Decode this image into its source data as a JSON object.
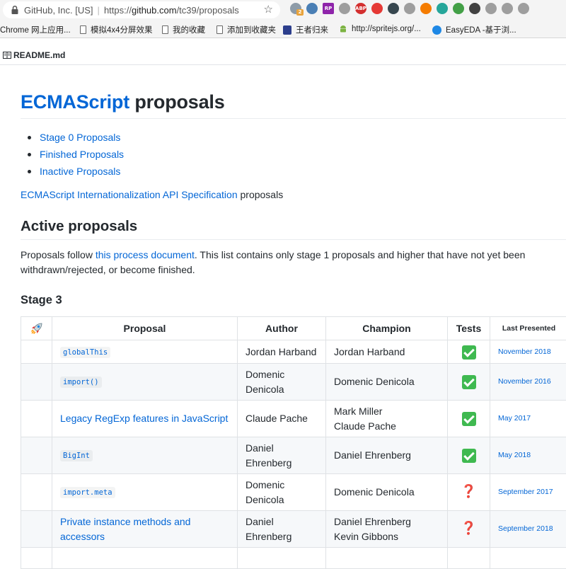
{
  "browser": {
    "site_identity": "GitHub, Inc. [US]",
    "url_prefix": "https://",
    "url_host": "github.com",
    "url_path": "/tc39/proposals",
    "extensions": [
      {
        "icon": "extension-badge-icon",
        "color": "#8d9ba8",
        "badge": "2"
      },
      {
        "icon": "extension-o-icon",
        "color": "#4a7fb5"
      },
      {
        "icon": "extension-rp-icon",
        "color": "#8e24aa",
        "label": "RP"
      },
      {
        "icon": "lightning-icon",
        "color": "#9e9e9e"
      },
      {
        "icon": "adblock-icon",
        "color": "#d32f2f",
        "label": "ABP"
      },
      {
        "icon": "extension-red-icon",
        "color": "#e53935"
      },
      {
        "icon": "extension-dark-icon",
        "color": "#37474f"
      },
      {
        "icon": "fox-icon",
        "color": "#9e9e9e"
      },
      {
        "icon": "extension-orange-icon",
        "color": "#f57c00"
      },
      {
        "icon": "extension-teal-icon",
        "color": "#26a69a"
      },
      {
        "icon": "wechat-icon",
        "color": "#43a047"
      },
      {
        "icon": "eyedropper-icon",
        "color": "#424242"
      },
      {
        "icon": "vue-icon",
        "color": "#9e9e9e"
      },
      {
        "icon": "refresh-icon",
        "color": "#9e9e9e"
      },
      {
        "icon": "extension-gray-icon",
        "color": "#9e9e9e"
      }
    ]
  },
  "bookmarks": [
    {
      "label": "Chrome 网上应用...",
      "icon": "apps-icon"
    },
    {
      "label": "模拟4x4分屏效果",
      "icon": "page-icon"
    },
    {
      "label": "我的收藏",
      "icon": "page-icon"
    },
    {
      "label": "添加到收藏夹",
      "icon": "page-icon"
    },
    {
      "label": "王者归来",
      "icon": "game-icon"
    },
    {
      "label": "http://spritejs.org/...",
      "icon": "android-icon"
    },
    {
      "label": "EasyEDA -基于浏...",
      "icon": "easyeda-icon"
    }
  ],
  "file_header": {
    "filename": "README.md"
  },
  "readme": {
    "title_link": "ECMAScript",
    "title_rest": " proposals",
    "toc": [
      "Stage 0 Proposals",
      "Finished Proposals",
      "Inactive Proposals"
    ],
    "intl_link": "ECMAScript Internationalization API Specification",
    "intl_rest": " proposals",
    "active_heading": "Active proposals",
    "desc_before": "Proposals follow ",
    "desc_link": "this process document",
    "desc_after": ". This list contains only stage 1 proposals and higher that have not yet been withdrawn/rejected, or become finished.",
    "stage_heading": "Stage 3"
  },
  "table": {
    "header_icon": "rocket-icon",
    "columns": [
      "Proposal",
      "Author",
      "Champion",
      "Tests",
      "Last Presented"
    ],
    "rows": [
      {
        "proposal": "globalThis",
        "code": true,
        "author": "Jordan Harband",
        "champion": [
          "Jordan Harband"
        ],
        "tests": "check",
        "date": "November 2018"
      },
      {
        "proposal": "import()",
        "code": true,
        "author": "Domenic Denicola",
        "champion": [
          "Domenic Denicola"
        ],
        "tests": "check",
        "date": "November 2016"
      },
      {
        "proposal": "Legacy RegExp features in JavaScript",
        "code": false,
        "author": "Claude Pache",
        "champion": [
          "Mark Miller",
          "Claude Pache"
        ],
        "tests": "check",
        "date": "May 2017"
      },
      {
        "proposal": "BigInt",
        "code": true,
        "author": "Daniel Ehrenberg",
        "champion": [
          "Daniel Ehrenberg"
        ],
        "tests": "check",
        "date": "May 2018"
      },
      {
        "proposal": "import.meta",
        "code": true,
        "author": "Domenic Denicola",
        "champion": [
          "Domenic Denicola"
        ],
        "tests": "question",
        "date": "September 2017"
      },
      {
        "proposal": "Private instance methods and accessors",
        "code": false,
        "author": "Daniel Ehrenberg",
        "champion": [
          "Daniel Ehrenberg",
          "Kevin Gibbons"
        ],
        "tests": "question",
        "date": "September 2018"
      },
      {
        "proposal": "",
        "code": false,
        "author": "",
        "champion": [],
        "tests": "",
        "date": ""
      }
    ]
  }
}
